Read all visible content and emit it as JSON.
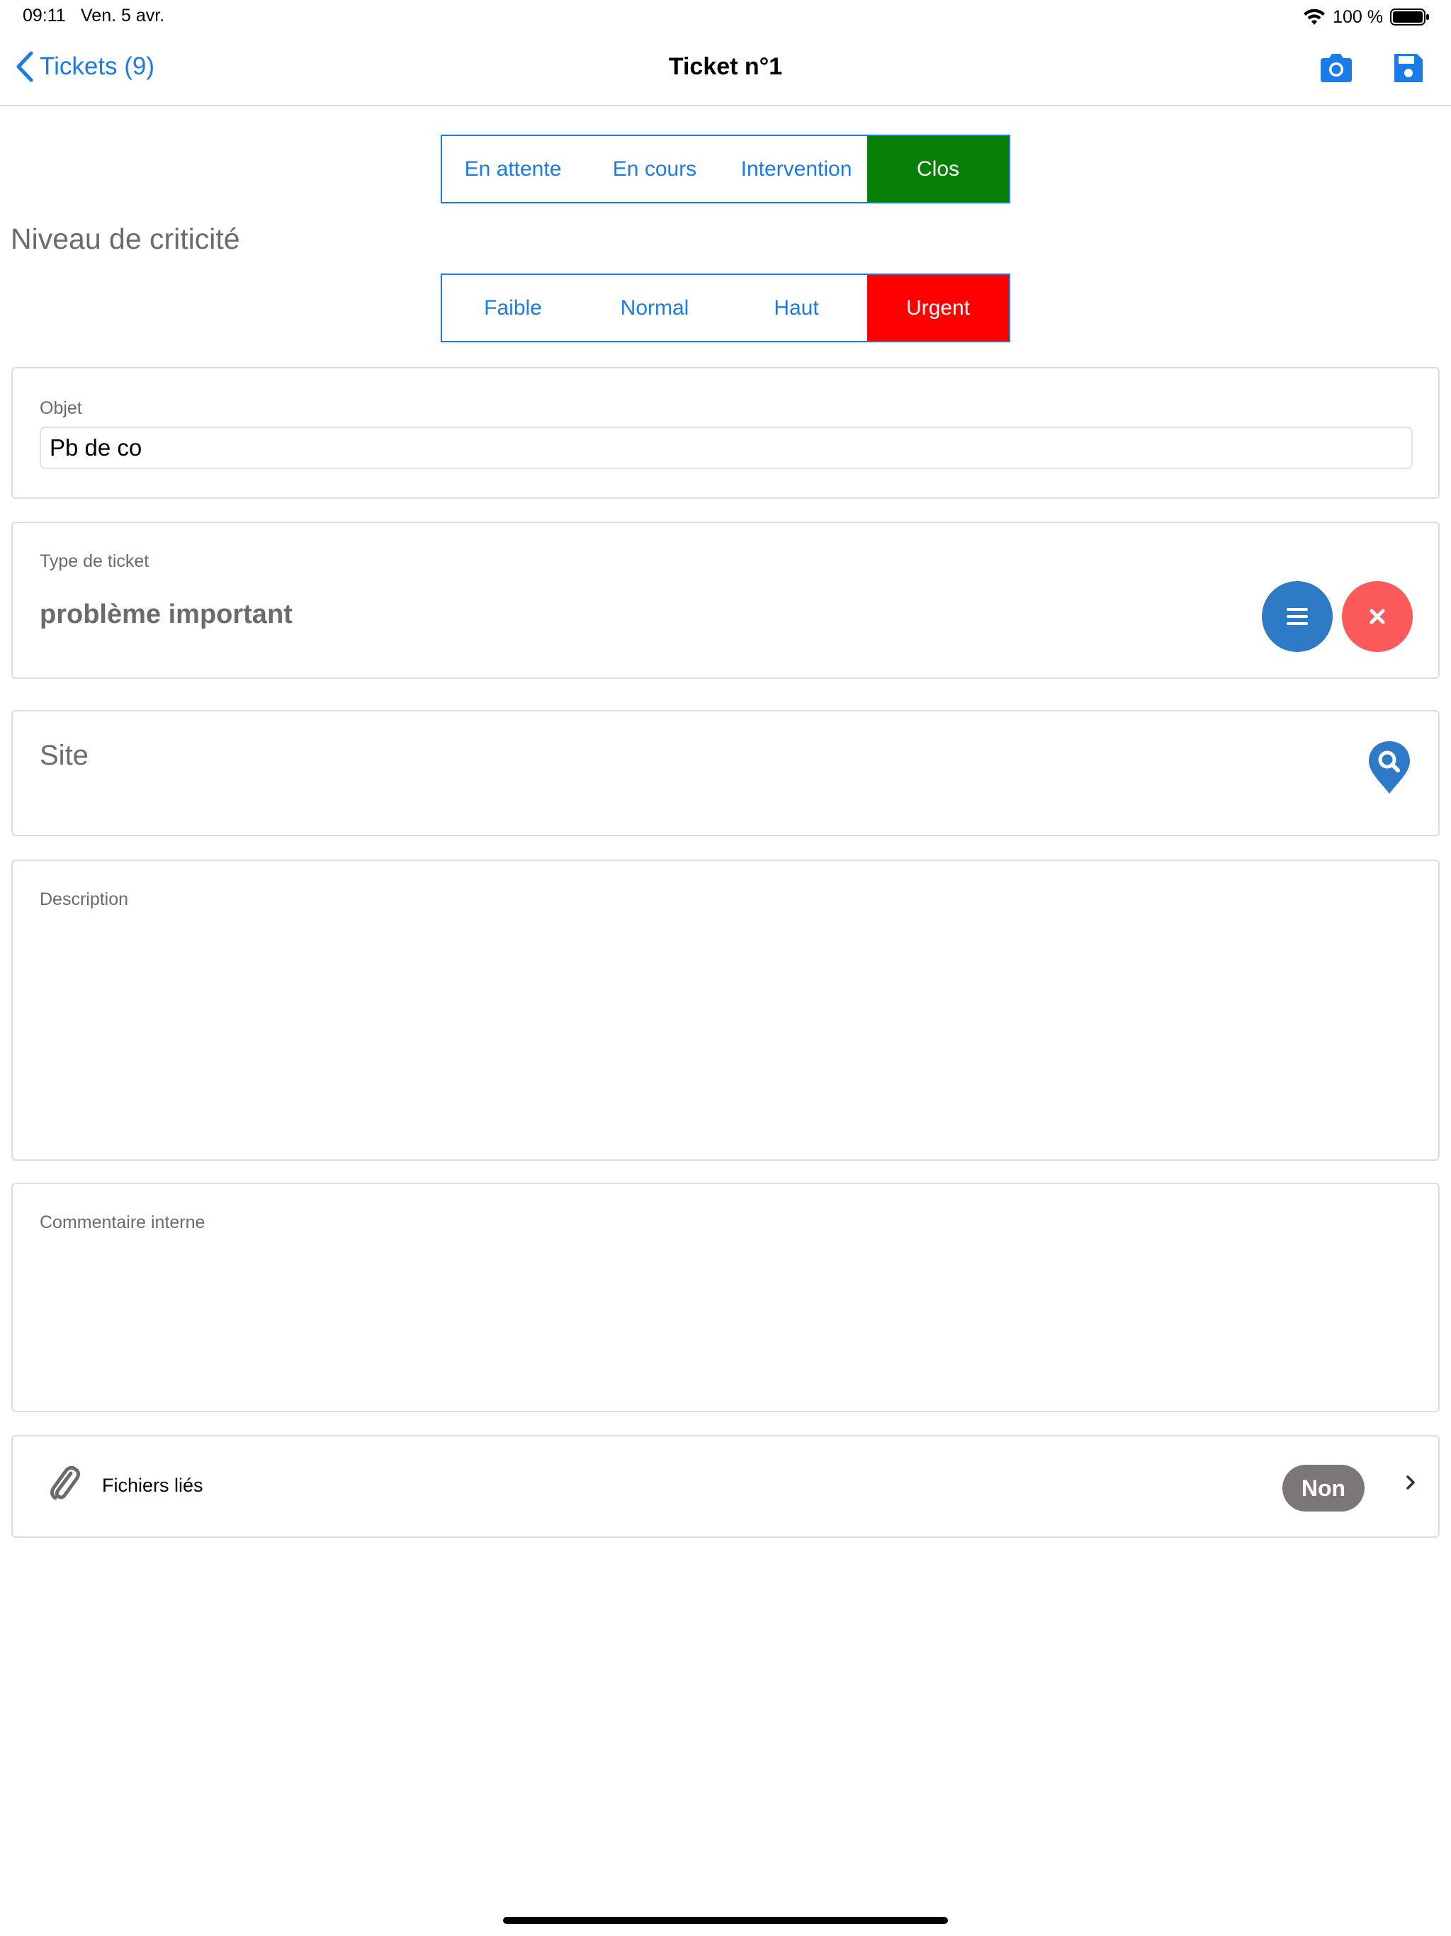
{
  "status_bar": {
    "time": "09:11",
    "date": "Ven. 5 avr.",
    "battery": "100 %",
    "icons": [
      "wifi-icon",
      "battery-icon"
    ]
  },
  "nav": {
    "back_label": "Tickets (9)",
    "title": "Ticket n°1",
    "icons": [
      "camera-icon",
      "save-icon"
    ]
  },
  "status_segment": {
    "items": [
      "En attente",
      "En cours",
      "Intervention",
      "Clos"
    ],
    "selected": "Clos",
    "selected_color": "#078007"
  },
  "criticality": {
    "label": "Niveau de criticité",
    "items": [
      "Faible",
      "Normal",
      "Haut",
      "Urgent"
    ],
    "selected": "Urgent",
    "selected_color": "#ff0000"
  },
  "objet": {
    "label": "Objet",
    "value": "Pb de co"
  },
  "ticket_type": {
    "label": "Type de ticket",
    "value": "problème important",
    "list_button_color": "#2f7ac6",
    "clear_button_color": "#fc5a5a"
  },
  "site": {
    "label": "Site",
    "search_icon": "map-search-icon"
  },
  "description": {
    "label": "Description",
    "value": ""
  },
  "internal_comment": {
    "label": "Commentaire interne",
    "value": ""
  },
  "files": {
    "label": "Fichiers liés",
    "badge": "Non",
    "icon": "paperclip-icon"
  },
  "colors": {
    "accent": "#1a7ce8"
  }
}
